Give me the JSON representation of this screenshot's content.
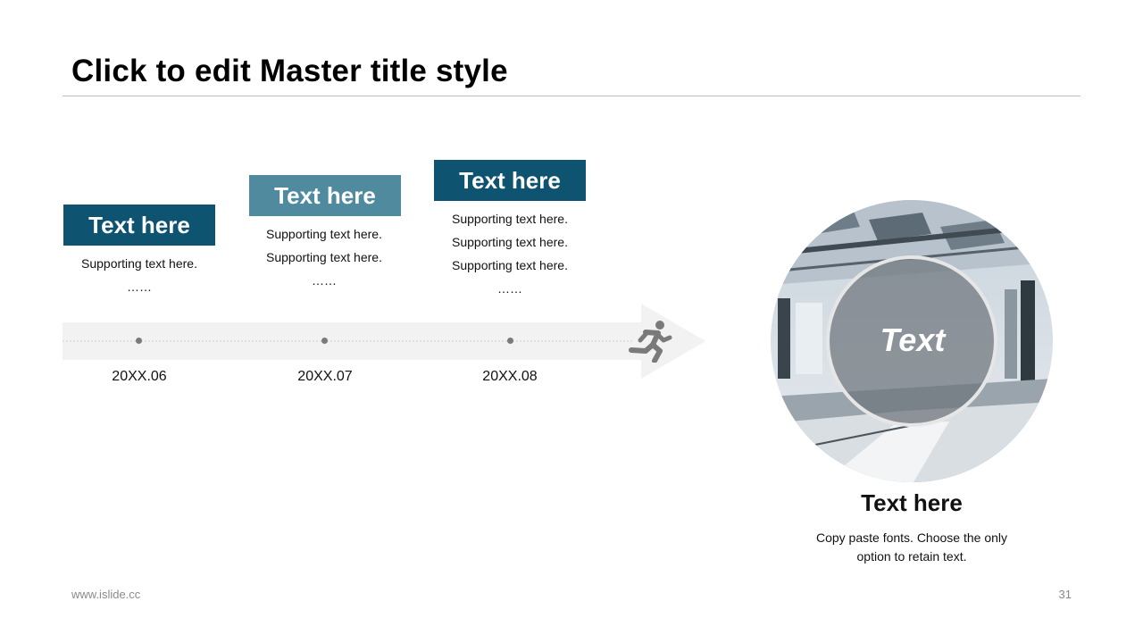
{
  "slide": {
    "title": "Click to edit Master title style"
  },
  "timeline": {
    "steps": [
      {
        "label": "Text here",
        "support": [
          "Supporting text here.",
          "……"
        ],
        "date": "20XX.06",
        "color": "#0e5471"
      },
      {
        "label": "Text here",
        "support": [
          "Supporting text here.",
          "Supporting text here.",
          "……"
        ],
        "date": "20XX.07",
        "color": "#4f8a9f"
      },
      {
        "label": "Text here",
        "support": [
          "Supporting text here.",
          "Supporting text here.",
          "Supporting text here.",
          "……"
        ],
        "date": "20XX.08",
        "color": "#0e5471"
      }
    ],
    "arrow_color": "#f2f2f2",
    "icon": "running-person-icon"
  },
  "card": {
    "overlay_text": "Text",
    "title": "Text here",
    "description": [
      "Copy paste fonts. Choose the only",
      "option to retain text."
    ]
  },
  "footer": {
    "website": "www.islide.cc",
    "page_number": "31"
  }
}
